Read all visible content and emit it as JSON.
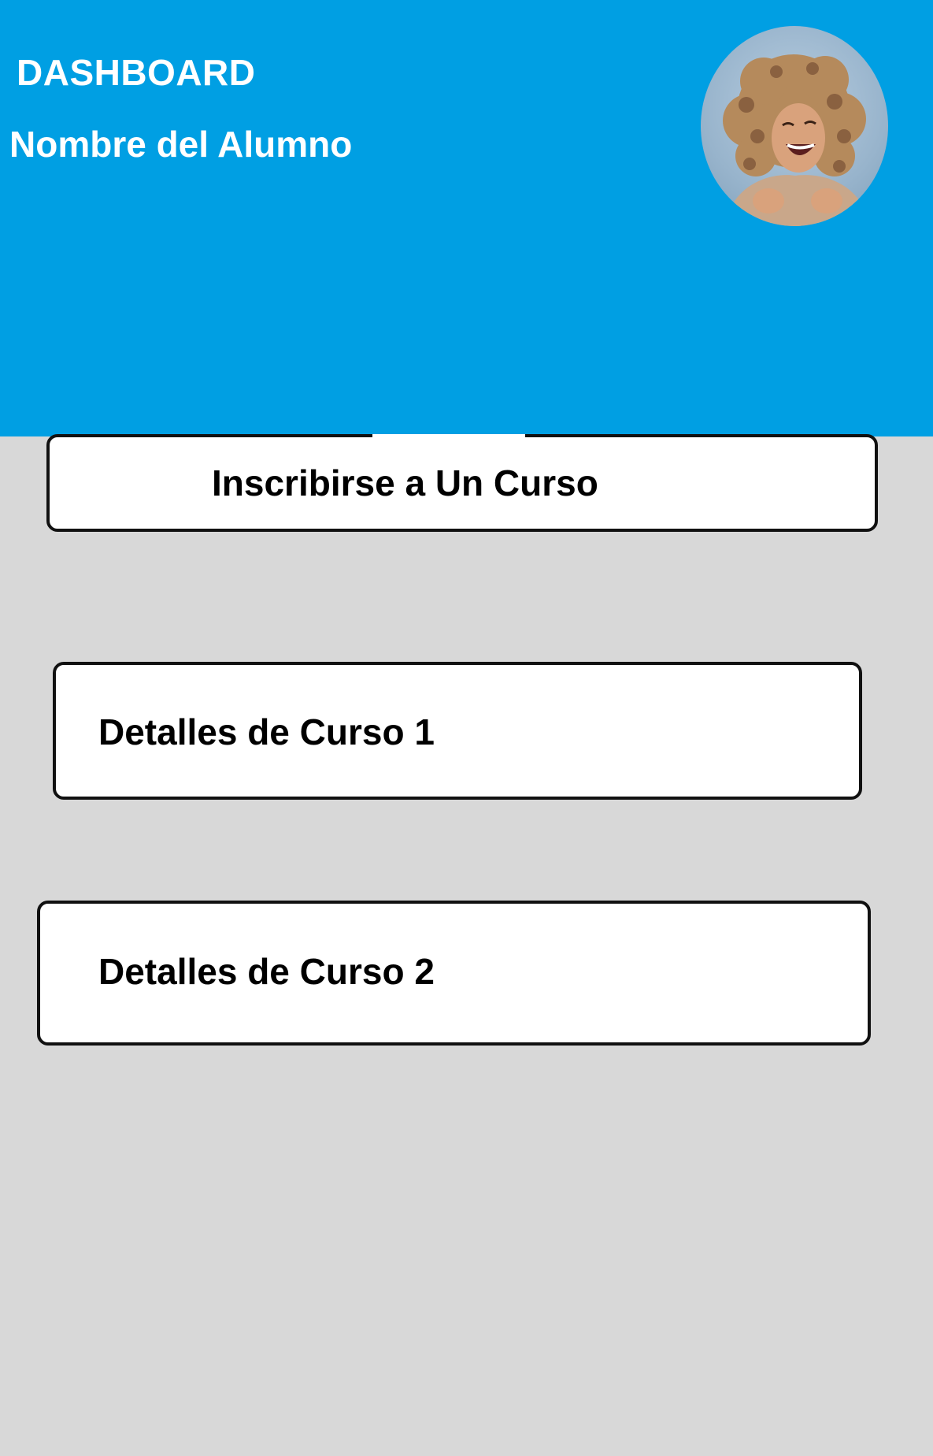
{
  "header": {
    "title": "DASHBOARD",
    "student_name": "Nombre del Alumno",
    "background_color": "#009fe3"
  },
  "avatar": {
    "icon": "student-photo-avatar"
  },
  "actions": {
    "enroll_label": "Inscribirse a Un Curso"
  },
  "courses": [
    {
      "label": "Detalles de Curso 1"
    },
    {
      "label": "Detalles de Curso 2"
    }
  ],
  "colors": {
    "page_background": "#d8d8d8",
    "card_background": "#ffffff",
    "card_border": "#111111"
  }
}
